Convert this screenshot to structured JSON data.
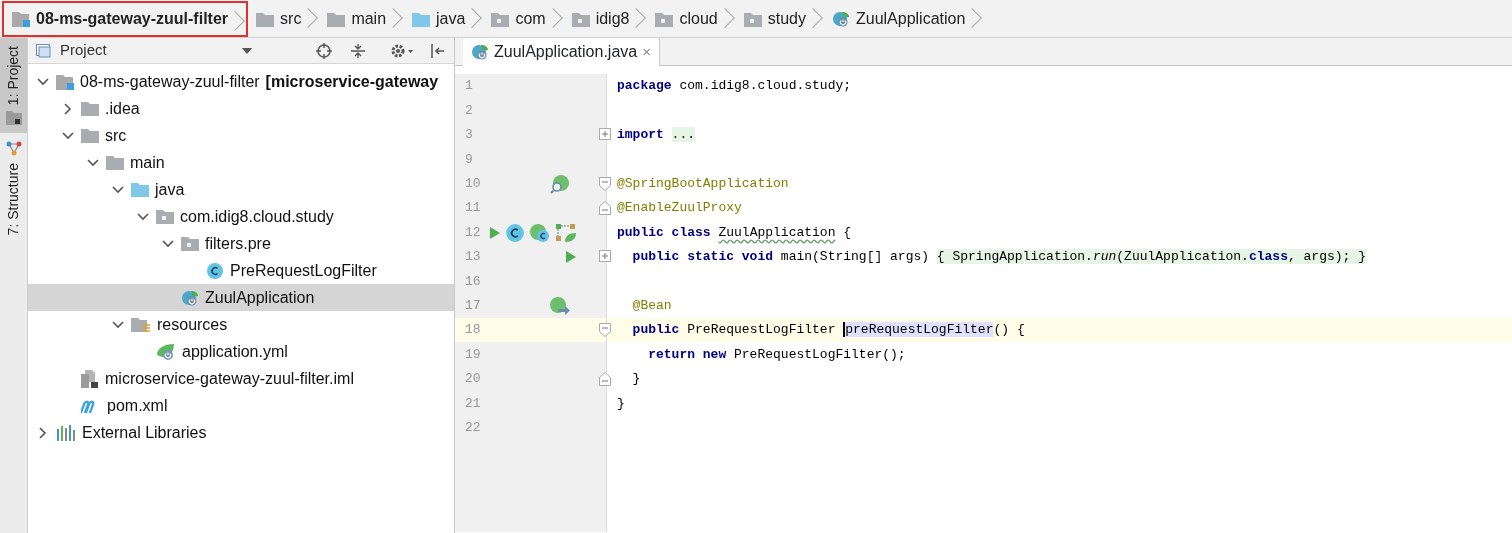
{
  "breadcrumbs": [
    {
      "label": "08-ms-gateway-zuul-filter",
      "kind": "module",
      "boxed": true
    },
    {
      "label": "src",
      "kind": "folder",
      "boxed": false
    },
    {
      "label": "main",
      "kind": "folder",
      "boxed": false
    },
    {
      "label": "java",
      "kind": "source",
      "boxed": false
    },
    {
      "label": "com",
      "kind": "package",
      "boxed": false
    },
    {
      "label": "idig8",
      "kind": "package",
      "boxed": false
    },
    {
      "label": "cloud",
      "kind": "package",
      "boxed": false
    },
    {
      "label": "study",
      "kind": "package",
      "boxed": false
    },
    {
      "label": "ZuulApplication",
      "kind": "app",
      "boxed": false
    }
  ],
  "tool_tabs": [
    {
      "label": "1: Project",
      "kind": "project",
      "selected": true
    },
    {
      "label": "7: Structure",
      "kind": "structure",
      "selected": false
    }
  ],
  "project_panel": {
    "title": "Project",
    "tree": [
      {
        "label": "08-ms-gateway-zuul-filter",
        "module": "[microservice-gateway",
        "kind": "module",
        "expanded": true,
        "selected": false,
        "children": [
          {
            "label": ".idea",
            "kind": "folder",
            "expanded": false,
            "selected": false
          },
          {
            "label": "src",
            "kind": "folder",
            "expanded": true,
            "selected": false,
            "children": [
              {
                "label": "main",
                "kind": "folder",
                "expanded": true,
                "selected": false,
                "children": [
                  {
                    "label": "java",
                    "kind": "source",
                    "expanded": true,
                    "selected": false,
                    "children": [
                      {
                        "label": "com.idig8.cloud.study",
                        "kind": "package",
                        "expanded": true,
                        "selected": false,
                        "children": [
                          {
                            "label": "filters.pre",
                            "kind": "package",
                            "expanded": true,
                            "selected": false,
                            "children": [
                              {
                                "label": "PreRequestLogFilter",
                                "kind": "class",
                                "selected": false
                              }
                            ]
                          },
                          {
                            "label": "ZuulApplication",
                            "kind": "app",
                            "selected": true
                          }
                        ]
                      }
                    ]
                  },
                  {
                    "label": "resources",
                    "kind": "resources",
                    "expanded": true,
                    "selected": false,
                    "children": [
                      {
                        "label": "application.yml",
                        "kind": "yml",
                        "selected": false
                      }
                    ]
                  }
                ]
              }
            ]
          },
          {
            "label": "microservice-gateway-zuul-filter.iml",
            "kind": "iml",
            "selected": false
          },
          {
            "label": "pom.xml",
            "kind": "maven",
            "selected": false
          }
        ]
      },
      {
        "label": "External Libraries",
        "kind": "libraries",
        "expanded": false,
        "selected": false
      }
    ]
  },
  "editor": {
    "tabs": [
      {
        "label": "ZuulApplication.java",
        "close": "×",
        "selected": true
      }
    ],
    "lines": [
      {
        "number": "1",
        "segments": [
          {
            "text": "package ",
            "kind": "keyword"
          },
          {
            "text": "com.idig8.cloud.study;",
            "kind": "plain"
          }
        ]
      },
      {
        "number": "2"
      },
      {
        "number": "3",
        "fold_marker": {
          "kind": "expand"
        },
        "segments": [
          {
            "text": "import ",
            "kind": "keyword"
          },
          {
            "text": "...",
            "kind": "folded"
          }
        ]
      },
      {
        "number": "9"
      },
      {
        "number": "10",
        "fold_marker": {
          "kind": "start"
        },
        "gutter": [
          {
            "kind": "bean-search"
          }
        ],
        "segments": [
          {
            "text": "@SpringBootApplication",
            "kind": "annotation"
          }
        ]
      },
      {
        "number": "11",
        "fold_marker": {
          "kind": "end"
        },
        "segments": [
          {
            "text": "@EnableZuulProxy",
            "kind": "annotation"
          }
        ]
      },
      {
        "number": "12",
        "gutter": [
          {
            "kind": "run"
          },
          {
            "kind": "class"
          },
          {
            "kind": "bean-class"
          },
          {
            "kind": "diagram"
          }
        ],
        "segments": [
          {
            "text": "public class ",
            "kind": "keyword"
          },
          {
            "text": "ZuulApplication",
            "kind": "typo"
          },
          {
            "text": " {",
            "kind": "plain"
          }
        ]
      },
      {
        "number": "13",
        "fold_marker": {
          "kind": "expand"
        },
        "gutter": [
          {
            "kind": "run"
          }
        ],
        "segments": [
          {
            "text": "  public static void",
            "kind": "keyword"
          },
          {
            "text": " main(String[] args) ",
            "kind": "plain"
          },
          {
            "text": "{ SpringApplication.",
            "kind": "folded"
          },
          {
            "text": "run",
            "kind": "folded-italic"
          },
          {
            "text": "(ZuulApplication.",
            "kind": "folded"
          },
          {
            "text": "class",
            "kind": "folded-keyword"
          },
          {
            "text": ", args); }",
            "kind": "folded"
          }
        ]
      },
      {
        "number": "16"
      },
      {
        "number": "17",
        "gutter": [
          {
            "kind": "bean-arrow"
          }
        ],
        "segments": [
          {
            "text": "  @Bean",
            "kind": "annotation"
          }
        ]
      },
      {
        "number": "18",
        "fold_marker": {
          "kind": "start"
        },
        "current": true,
        "segments": [
          {
            "text": "  public",
            "kind": "keyword"
          },
          {
            "text": " PreRequestLogFilter ",
            "kind": "plain"
          },
          {
            "text": "preRequestLogFilter",
            "kind": "caret-highlight"
          },
          {
            "text": "() {",
            "kind": "plain"
          }
        ]
      },
      {
        "number": "19",
        "segments": [
          {
            "text": "    return new",
            "kind": "keyword"
          },
          {
            "text": " PreRequestLogFilter();",
            "kind": "plain"
          }
        ]
      },
      {
        "number": "20",
        "fold_marker": {
          "kind": "end"
        },
        "segments": [
          {
            "text": "  }",
            "kind": "plain"
          }
        ]
      },
      {
        "number": "21",
        "segments": [
          {
            "text": "}",
            "kind": "plain"
          }
        ]
      },
      {
        "number": "22"
      }
    ]
  }
}
